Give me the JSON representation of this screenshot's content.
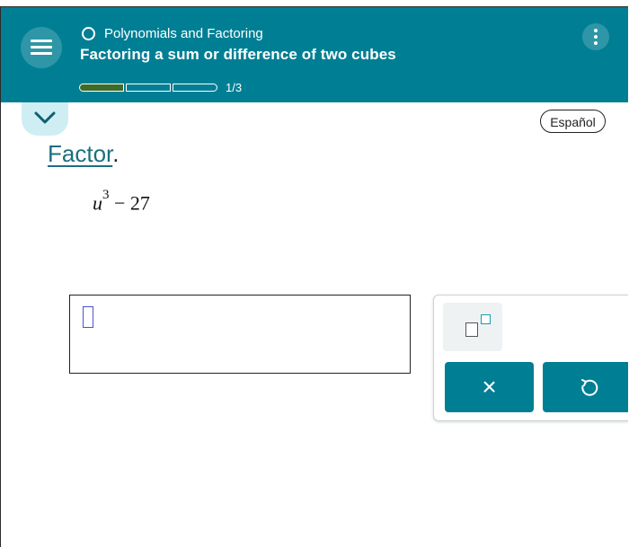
{
  "header": {
    "topic": "Polynomials and Factoring",
    "title": "Factoring a sum or difference of two cubes",
    "progress": {
      "label": "1/3",
      "current": 1,
      "total": 3
    }
  },
  "language_button": "Español",
  "instruction": {
    "word": "Factor",
    "period": "."
  },
  "problem": {
    "variable": "u",
    "exponent": "3",
    "rest": " − 27"
  },
  "keypad": {
    "clear_label": "×"
  },
  "colors": {
    "header": "#007f94",
    "progress_done": "#3c6b2a",
    "tab": "#cfeef3"
  },
  "icons": [
    "menu-icon",
    "circle-icon",
    "more-vertical-icon",
    "chevron-down-icon",
    "exponent-icon",
    "undo-icon"
  ]
}
